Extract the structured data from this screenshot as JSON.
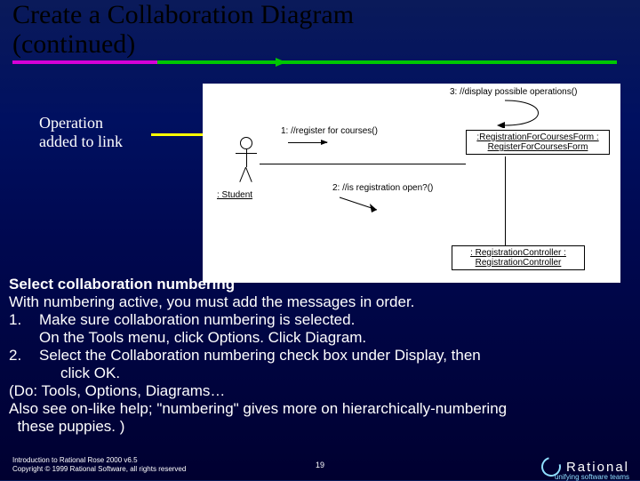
{
  "title_line1": "Create a Collaboration Diagram",
  "title_line2": "(continued)",
  "annotation": {
    "l1": "Operation",
    "l2": "added to link"
  },
  "diagram": {
    "msg1": "1: //register for courses()",
    "msg2": "2: //is registration open?()",
    "msg3": "3: //display possible operations()",
    "student": ": Student",
    "form": {
      "l1": ":RegistrationForCoursesForm :",
      "l2": "RegisterForCoursesForm"
    },
    "controller": {
      "l1": ": RegistrationController :",
      "l2": "RegistrationController"
    }
  },
  "body": {
    "h": "Select collaboration numbering",
    "intro": "With numbering active, you must add the messages in order.",
    "s1": "Make sure collaboration numbering is selected.",
    "s1b": "On the Tools menu, click Options. Click Diagram.",
    "s2": "Select the Collaboration numbering check box under Display, then",
    "s2b": "click OK.",
    "do": "(Do:  Tools, Options,  Diagrams…",
    "also": "Also see on-like help; \"numbering\"  gives more on hierarchically-numbering",
    "pup": "  these puppies. )"
  },
  "footer": {
    "course": "Introduction to Rational Rose 2000 v6.5",
    "copy": "Copyright © 1999 Rational Software, all rights reserved",
    "page": "19",
    "brand": "Rational",
    "tagline": "unifying software teams"
  }
}
